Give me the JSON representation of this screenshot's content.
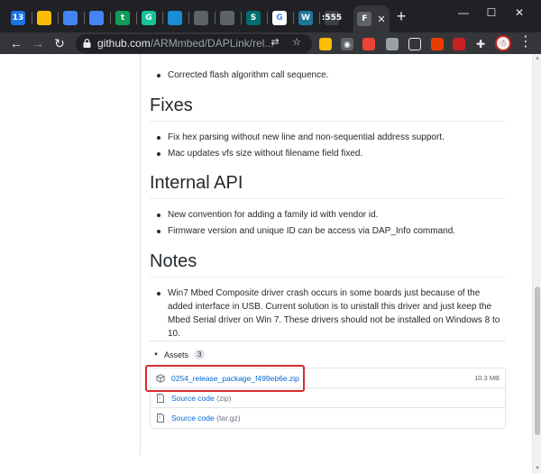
{
  "browser": {
    "tabs": [
      {
        "icon": "calendar-icon",
        "glyph": "13",
        "color": "#1a73e8"
      },
      {
        "icon": "drive-icon",
        "glyph": "",
        "color": "#fbbc04"
      },
      {
        "icon": "docs-icon",
        "glyph": "",
        "color": "#4285f4"
      },
      {
        "icon": "docs-icon",
        "glyph": "",
        "color": "#4285f4"
      },
      {
        "icon": "sheets-plus-icon",
        "glyph": "t",
        "color": "#0f9d58"
      },
      {
        "icon": "grammarly-icon",
        "glyph": "G",
        "color": "#15c39a"
      },
      {
        "icon": "wave-icon",
        "glyph": "",
        "color": "#1a8cd8"
      },
      {
        "icon": "bolt-icon",
        "glyph": "",
        "color": "#5f6368"
      },
      {
        "icon": "globe-icon",
        "glyph": "",
        "color": "#5f6368"
      },
      {
        "icon": "sharepoint-icon",
        "glyph": "S",
        "color": "#036c70"
      },
      {
        "icon": "google-icon",
        "glyph": "G",
        "color": "#ffffff"
      },
      {
        "icon": "wordpress-icon",
        "glyph": "W",
        "color": "#21759b"
      },
      {
        "icon": "dotted-icon",
        "glyph": ":555",
        "color": "#3c4043"
      }
    ],
    "active_tab_glyph": "F",
    "url_host": "github.com",
    "url_path": "/ARMmbed/DAPLink/rel..."
  },
  "release": {
    "previous_items": [
      "Corrected flash algorithm call sequence."
    ],
    "sections": [
      {
        "title": "Fixes",
        "items": [
          "Fix hex parsing without new line and non-sequential address support.",
          "Mac updates vfs size without filename field fixed."
        ]
      },
      {
        "title": "Internal API",
        "items": [
          "New convention for adding a family id with vendor id.",
          "Firmware version and unique ID can be access via DAP_Info command."
        ]
      },
      {
        "title": "Notes",
        "items": [
          "Win7 Mbed Composite driver crash occurs in some boards just because of the added interface in USB. Current solution is to unistall this driver and just keep the Mbed Serial driver on Win 7. These drivers should not be installed on Windows 8 to 10."
        ]
      }
    ]
  },
  "assets": {
    "label": "Assets",
    "count": "3",
    "files": [
      {
        "name": "0254_release_package_f499eb6e.zip",
        "size": "10.3 MB",
        "icon": "package-icon"
      },
      {
        "name": "Source code",
        "format": "(zip)",
        "icon": "file-zip-icon"
      },
      {
        "name": "Source code",
        "format": "(tar.gz)",
        "icon": "file-zip-icon"
      }
    ]
  },
  "colors": {
    "highlight": "#d92b2b",
    "link": "#0366d6",
    "chrome_dark": "#202124"
  }
}
